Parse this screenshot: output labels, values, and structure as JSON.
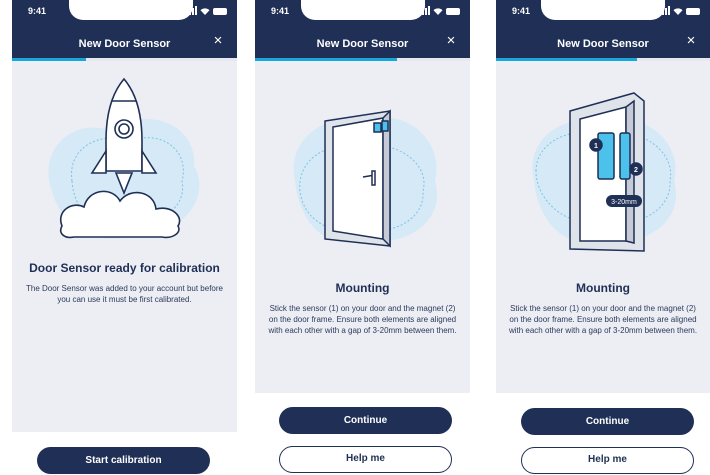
{
  "status_bar": {
    "time": "9:41"
  },
  "screens": [
    {
      "title": "New Door Sensor",
      "close_icon": "×",
      "progress": 0.33,
      "heading": "Door Sensor ready for calibration",
      "description": "The Door Sensor was added to your account but before you can use it must be first calibrated.",
      "primary_button": "Start calibration"
    },
    {
      "title": "New Door Sensor",
      "close_icon": "×",
      "progress": 0.66,
      "heading": "Mounting",
      "description": "Stick the sensor (1) on your door and the magnet (2) on the door frame. Ensure both elements are aligned with each other with a gap of 3-20mm between them.",
      "primary_button": "Continue",
      "secondary_button": "Help me"
    },
    {
      "title": "New Door Sensor",
      "close_icon": "×",
      "progress": 0.66,
      "heading": "Mounting",
      "description": "Stick the sensor (1) on your door and the magnet (2) on the door frame. Ensure both elements are aligned with each other with a gap of 3-20mm between them.",
      "primary_button": "Continue",
      "secondary_button": "Help me",
      "diagram": {
        "label_sensor": "1",
        "label_magnet": "2",
        "gap_label": "3-20mm"
      }
    }
  ],
  "colors": {
    "navy": "#1f2f55",
    "accent": "#18a7dd",
    "background": "#eceef4"
  }
}
